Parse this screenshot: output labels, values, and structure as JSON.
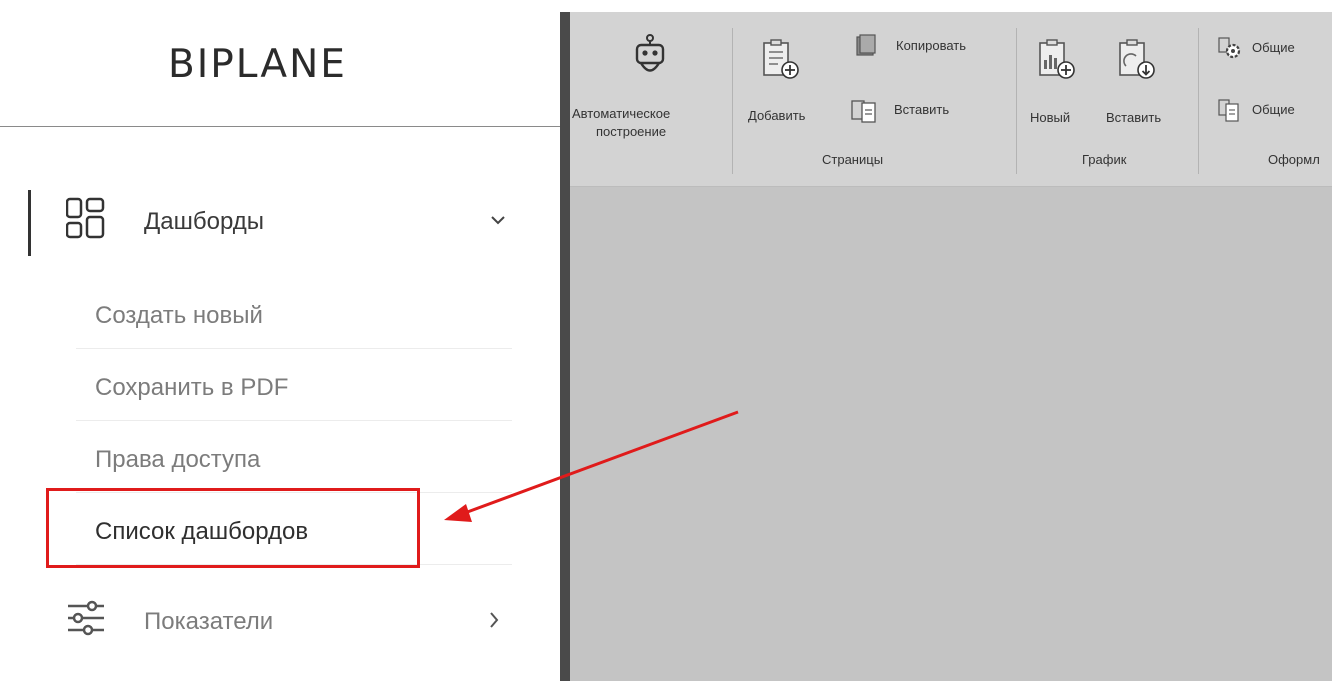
{
  "brand": {
    "logo_text": "BIPLANE"
  },
  "sidebar": {
    "section": {
      "label": "Дашборды",
      "icon": "dashboard-grid-icon",
      "expanded": true,
      "items": [
        {
          "label": "Создать новый"
        },
        {
          "label": "Сохранить в PDF"
        },
        {
          "label": "Права доступа"
        },
        {
          "label": "Список дашбордов",
          "highlighted": true
        }
      ]
    },
    "section2": {
      "label": "Показатели",
      "icon": "sliders-icon",
      "expanded": false
    }
  },
  "ribbon": {
    "auto_build": {
      "label_line1": "Автоматическое",
      "label_line2": "построение",
      "icon": "robot-icon"
    },
    "pages_group": {
      "label": "Страницы",
      "add_label": "Добавить",
      "copy_label": "Копировать",
      "paste_label": "Вставить"
    },
    "chart_group": {
      "label": "График",
      "new_label": "Новый",
      "paste_label": "Вставить"
    },
    "design_group": {
      "label": "Оформл",
      "common1_label": "Общие",
      "common2_label": "Общие"
    }
  },
  "annotation": {
    "color": "#e01b1b"
  },
  "colors": {
    "ribbon_bg": "#d3d3d3",
    "workspace_bg": "#c4c4c4",
    "highlight": "#e01b1b"
  }
}
